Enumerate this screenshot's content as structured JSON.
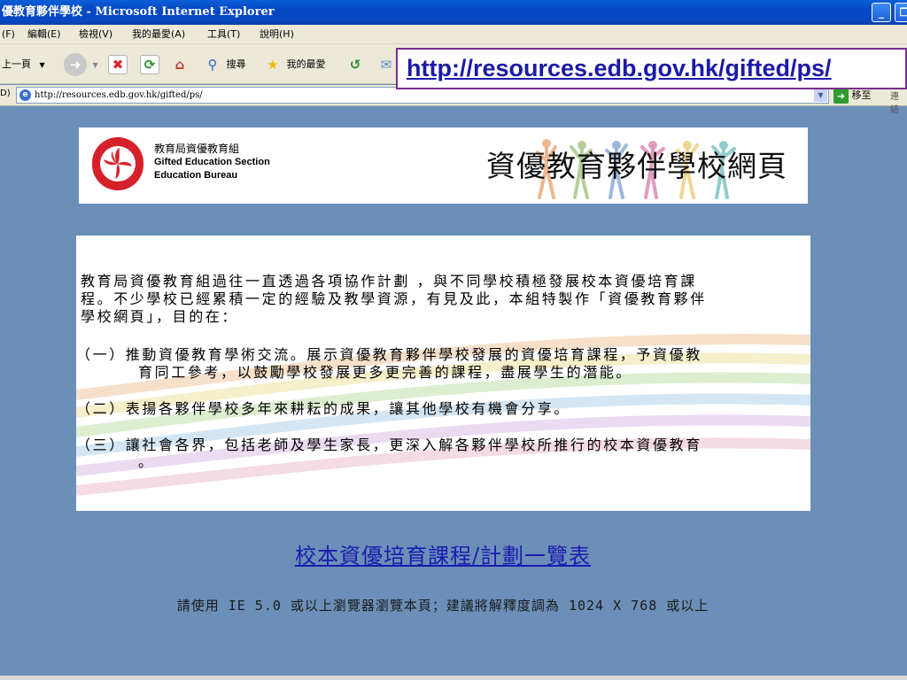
{
  "window": {
    "title": "優教育夥伴學校 - Microsoft Internet Explorer",
    "minimize_icon": "minimize-icon",
    "restore_icon": "restore-icon"
  },
  "menu": {
    "file": "(F)",
    "edit": "編輯(E)",
    "view": "檢視(V)",
    "favorites": "我的最愛(A)",
    "tools": "工具(T)",
    "help": "說明(H)"
  },
  "toolbar": {
    "back": "上一頁",
    "search": "搜尋",
    "favorites": "我的最愛"
  },
  "address": {
    "label": "D)",
    "url": "http://resources.edb.gov.hk/gifted/ps/",
    "go": "移至",
    "links": "連結"
  },
  "callout": {
    "url": "http://resources.edb.gov.hk/gifted/ps/"
  },
  "banner": {
    "bureau_zh": "教育局資優教育組",
    "bureau_en1": "Gifted Education Section",
    "bureau_en2": "Education Bureau",
    "title": "資優教育夥伴學校網頁"
  },
  "content": {
    "intro_line1": "教育局資優教育組過往一直透過各項協作計劃 ，與不同學校積極發展校本資優培育課",
    "intro_line2": "程。不少學校已經累積一定的經驗及教學資源，有見及此，本組特製作「資優教育夥伴",
    "intro_line3": "學校網頁」，目的在：",
    "item1_line1": "（一）推動資優教育學術交流。展示資優教育夥伴學校發展的資優培育課程，予資優教",
    "item1_line2": "育同工參考，以鼓勵學校發展更多更完善的課程，盡展學生的潛能。",
    "item2": "（二）表揚各夥伴學校多年來耕耘的成果，讓其他學校有機會分享。",
    "item3_line1": "（三）讓社會各界，包括老師及學生家長，更深入解各夥伴學校所推行的校本資優教育",
    "item3_line2": "。"
  },
  "footer": {
    "link": "校本資優培育課程/計劃一覽表",
    "note": "請使用 IE 5.0 或以上瀏覽器瀏覽本頁；建議將解釋度調為 1024 X 768 或以上"
  }
}
